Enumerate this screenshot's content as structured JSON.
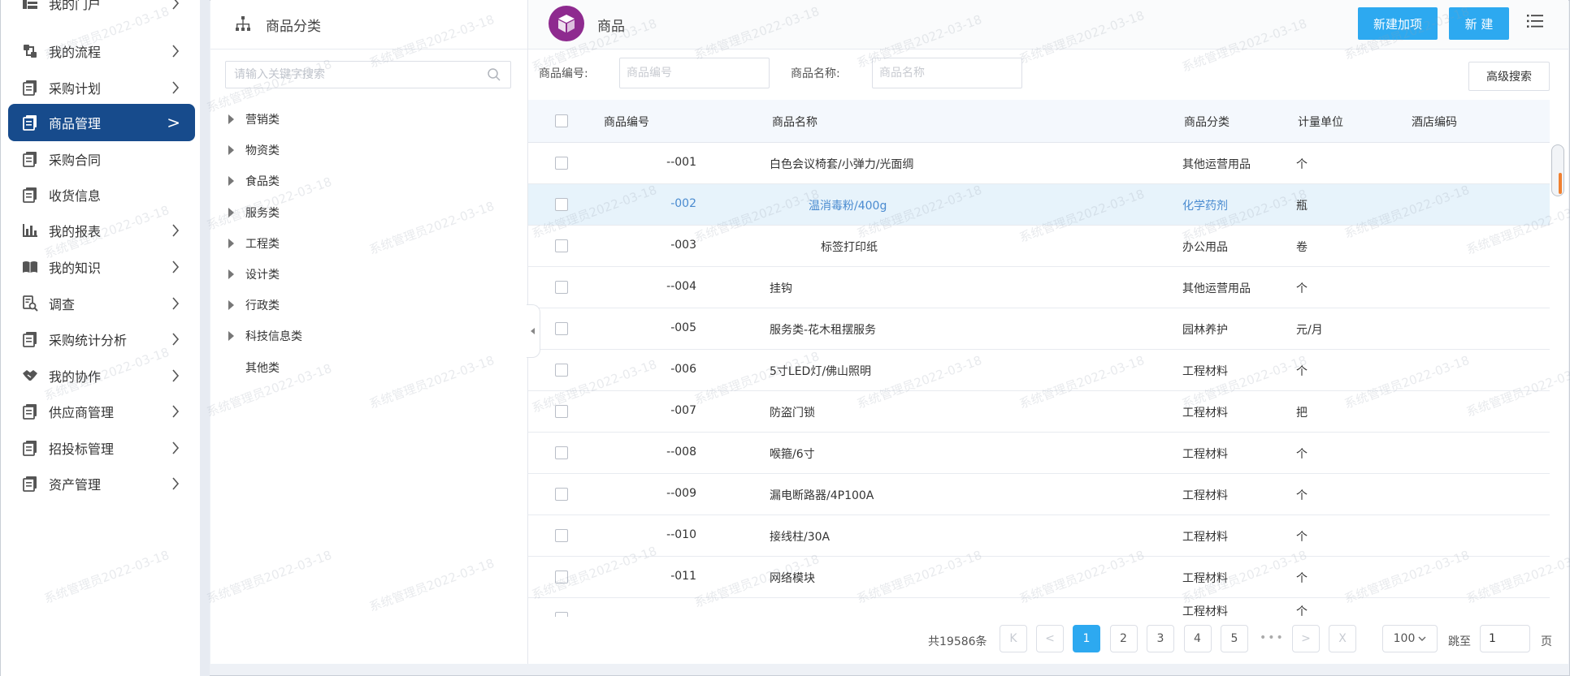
{
  "nav": {
    "items": [
      {
        "label": "我的门户",
        "icon": "portal-icon",
        "has_arrow": true
      },
      {
        "label": "我的流程",
        "icon": "flow-icon",
        "has_arrow": true
      },
      {
        "label": "采购计划",
        "icon": "document-icon",
        "has_arrow": true
      },
      {
        "label": "商品管理",
        "icon": "document-icon",
        "has_arrow": true,
        "active": true,
        "arrow_text": ">"
      },
      {
        "label": "采购合同",
        "icon": "document-icon",
        "has_arrow": false
      },
      {
        "label": "收货信息",
        "icon": "document-icon",
        "has_arrow": false
      },
      {
        "label": "我的报表",
        "icon": "bar-chart-icon",
        "has_arrow": true
      },
      {
        "label": "我的知识",
        "icon": "book-icon",
        "has_arrow": true
      },
      {
        "label": "调查",
        "icon": "survey-icon",
        "has_arrow": true
      },
      {
        "label": "采购统计分析",
        "icon": "document-icon",
        "has_arrow": true
      },
      {
        "label": "我的协作",
        "icon": "handshake-icon",
        "has_arrow": true
      },
      {
        "label": "供应商管理",
        "icon": "document-icon",
        "has_arrow": true
      },
      {
        "label": "招投标管理",
        "icon": "document-icon",
        "has_arrow": true
      },
      {
        "label": "资产管理",
        "icon": "document-icon",
        "has_arrow": true
      }
    ]
  },
  "category": {
    "title": "商品分类",
    "search_placeholder": "请输入关键字搜索",
    "tree": [
      {
        "label": "营销类",
        "expandable": true
      },
      {
        "label": "物资类",
        "expandable": true
      },
      {
        "label": "食品类",
        "expandable": true
      },
      {
        "label": "服务类",
        "expandable": true
      },
      {
        "label": "工程类",
        "expandable": true
      },
      {
        "label": "设计类",
        "expandable": true
      },
      {
        "label": "行政类",
        "expandable": true
      },
      {
        "label": "科技信息类",
        "expandable": true
      },
      {
        "label": "其他类",
        "expandable": false
      }
    ]
  },
  "main": {
    "title": "商品",
    "btn_new_add": "新建加项",
    "btn_new": "新 建",
    "filters": {
      "code_label": "商品编号:",
      "code_placeholder": "商品编号",
      "name_label": "商品名称:",
      "name_placeholder": "商品名称",
      "advanced": "高级搜索"
    },
    "columns": [
      "商品编号",
      "商品名称",
      "商品分类",
      "计量单位",
      "酒店编码"
    ],
    "rows": [
      {
        "code": "--001",
        "name": "白色会议椅套/小弹力/光面绸",
        "category": "其他运营用品",
        "unit": "个",
        "hotel": ""
      },
      {
        "code": "-002",
        "name": "温消毒粉/400g",
        "category": "化学药剂",
        "unit": "瓶",
        "hotel": "",
        "selected": true
      },
      {
        "code": "-003",
        "name": "标签打印纸",
        "category": "办公用品",
        "unit": "卷",
        "hotel": ""
      },
      {
        "code": "--004",
        "name": "挂钩",
        "category": "其他运营用品",
        "unit": "个",
        "hotel": ""
      },
      {
        "code": "-005",
        "name": "服务类-花木租摆服务",
        "category": "园林养护",
        "unit": "元/月",
        "hotel": ""
      },
      {
        "code": "-006",
        "name": "5寸LED灯/佛山照明",
        "category": "工程材料",
        "unit": "个",
        "hotel": ""
      },
      {
        "code": "-007",
        "name": "防盗门锁",
        "category": "工程材料",
        "unit": "把",
        "hotel": ""
      },
      {
        "code": "--008",
        "name": "喉箍/6寸",
        "category": "工程材料",
        "unit": "个",
        "hotel": ""
      },
      {
        "code": "--009",
        "name": "漏电断路器/4P100A",
        "category": "工程材料",
        "unit": "个",
        "hotel": ""
      },
      {
        "code": "--010",
        "name": "接线柱/30A",
        "category": "工程材料",
        "unit": "个",
        "hotel": ""
      },
      {
        "code": "-011",
        "name": "网络模块",
        "category": "工程材料",
        "unit": "个",
        "hotel": ""
      },
      {
        "code": "",
        "name": "",
        "category": "工程材料",
        "unit": "个",
        "hotel": ""
      }
    ],
    "pagination": {
      "total": "共19586条",
      "first": "K",
      "prev": "<",
      "pages": [
        "1",
        "2",
        "3",
        "4",
        "5"
      ],
      "current": "1",
      "ellipsis": "•••",
      "next": ">",
      "last": "X",
      "page_size": "100",
      "jump_label": "跳至",
      "jump_value": "1",
      "page_suffix": "页"
    }
  },
  "watermark": "系统管理员2022-03-18",
  "colors": {
    "nav_active": "#174b8c",
    "primary": "#2da9f0",
    "logo": "#8e2a8f",
    "selected_row": "#e7f3fb"
  }
}
